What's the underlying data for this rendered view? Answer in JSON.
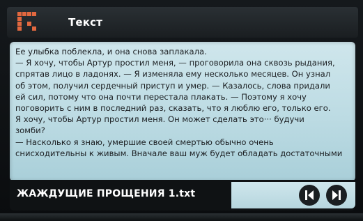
{
  "titlebar": {
    "logo_icon": "app-logo-icon",
    "title": "Текст"
  },
  "reader": {
    "lines": [
      "Ее улыбка поблекла, и она снова заплакала.",
      "— Я хочу, чтобы Артур простил меня, — проговорила она сквозь рыдания,",
      "спрятав лицо в ладонях. — Я изменяла ему несколько месяцев. Он узнал",
      "об этом, получил сердечный приступ и умер. — Казалось, слова придали",
      "ей сил, потому что она почти перестала плакать. — Поэтому я хочу",
      "поговорить с ним в последний раз, сказать, что я люблю его, только его.",
      "Я хочу, чтобы Артур простил меня. Он может сделать это··· будучи",
      "зомби?",
      "— Насколько я знаю, умершие своей смертью обычно очень",
      "снисходительны к живым. Вначале ваш муж будет обладать достаточными"
    ]
  },
  "bottombar": {
    "filename": "ЖАЖДУЩИЕ ПРОЩЕНИЯ 1.txt",
    "prev_icon": "previous-page-icon",
    "next_icon": "next-page-icon"
  },
  "colors": {
    "panel": "#c3e0e7",
    "logo": "#e2683f",
    "bar": "#0f1214"
  }
}
